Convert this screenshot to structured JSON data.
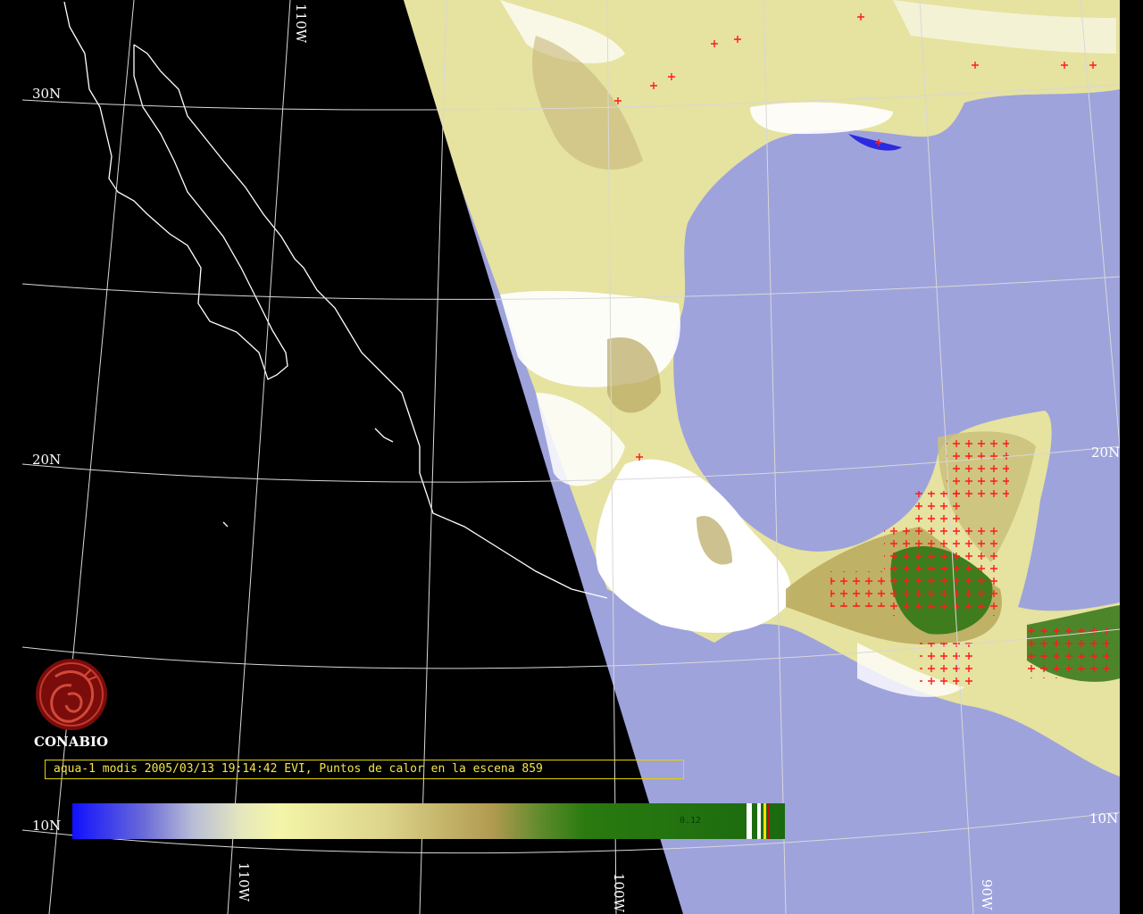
{
  "map": {
    "latitude_labels": [
      "30N",
      "20N",
      "10N",
      "20N",
      "10N"
    ],
    "longitude_labels": [
      "110W",
      "110W",
      "100W",
      "90W"
    ],
    "hotspot_symbol": "+",
    "colors": {
      "ocean": "#9ea3dc",
      "land_dry": "#e6e2a0",
      "land_veg": "#3f7c1e",
      "cloud": "#ffffff",
      "hotspot": "#ff1a1a",
      "coastline": "#ffffff",
      "grid": "#d8d8d8"
    }
  },
  "logo": {
    "org_name": "CONABIO",
    "icon": "conabio-seal-icon",
    "color": "#8b0f0f"
  },
  "caption": {
    "text": "aqua-1 modis 2005/03/13 19:14:42 EVI, Puntos de calor en la escena 859"
  },
  "colorbar": {
    "tick_label": "0.12",
    "start_color": "#1010ff",
    "end_color": "#1a6a10"
  }
}
